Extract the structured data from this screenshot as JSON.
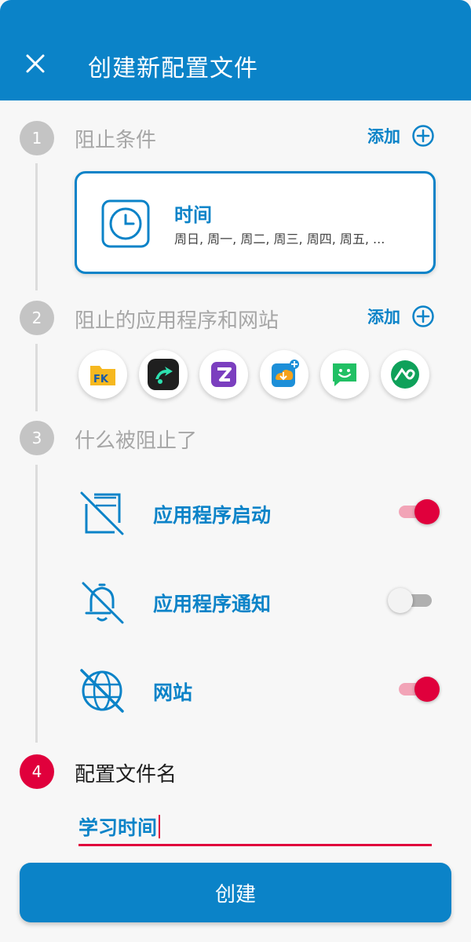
{
  "header": {
    "title": "创建新配置文件",
    "close_icon": "close-icon"
  },
  "colors": {
    "primary": "#0b83c8",
    "accent": "#e0003c",
    "inactive_step": "#c4c4c4"
  },
  "steps": [
    {
      "number": "1",
      "title": "阻止条件",
      "add_label": "添加"
    },
    {
      "number": "2",
      "title": "阻止的应用程序和网站",
      "add_label": "添加"
    },
    {
      "number": "3",
      "title": "什么被阻止了"
    },
    {
      "number": "4",
      "title": "配置文件名"
    }
  ],
  "condition_card": {
    "icon": "clock-icon",
    "title": "时间",
    "subtitle": "周日, 周一, 周二, 周三, 周四, 周五, ..."
  },
  "apps": [
    {
      "icon": "file-manager-app-icon"
    },
    {
      "icon": "video-player-app-icon"
    },
    {
      "icon": "zedge-app-icon"
    },
    {
      "icon": "downloader-app-icon"
    },
    {
      "icon": "messages-app-icon"
    },
    {
      "icon": "vpn-app-icon"
    }
  ],
  "blocked": [
    {
      "label": "应用程序启动",
      "icon": "app-launch-blocked-icon",
      "enabled": true
    },
    {
      "label": "应用程序通知",
      "icon": "notification-blocked-icon",
      "enabled": false
    },
    {
      "label": "网站",
      "icon": "website-blocked-icon",
      "enabled": true
    }
  ],
  "profile_name": {
    "value": "学习时间"
  },
  "create_button": {
    "label": "创建"
  }
}
